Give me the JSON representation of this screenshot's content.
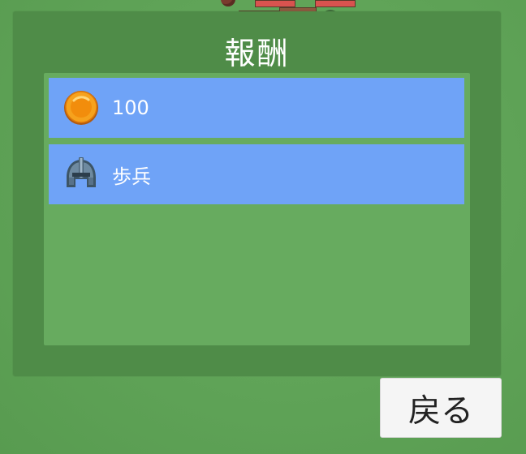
{
  "panel": {
    "title": "報酬"
  },
  "rewards": [
    {
      "icon": "gold-coin-icon",
      "label": "100"
    },
    {
      "icon": "knight-helmet-icon",
      "label": "歩兵"
    }
  ],
  "back_button": {
    "label": "戻る"
  },
  "colors": {
    "background": "#62a659",
    "panel": "#4f8c48",
    "list_area": "#67ab5f",
    "reward_item": "#6fa3f7",
    "back_button": "#f5f5f5"
  }
}
